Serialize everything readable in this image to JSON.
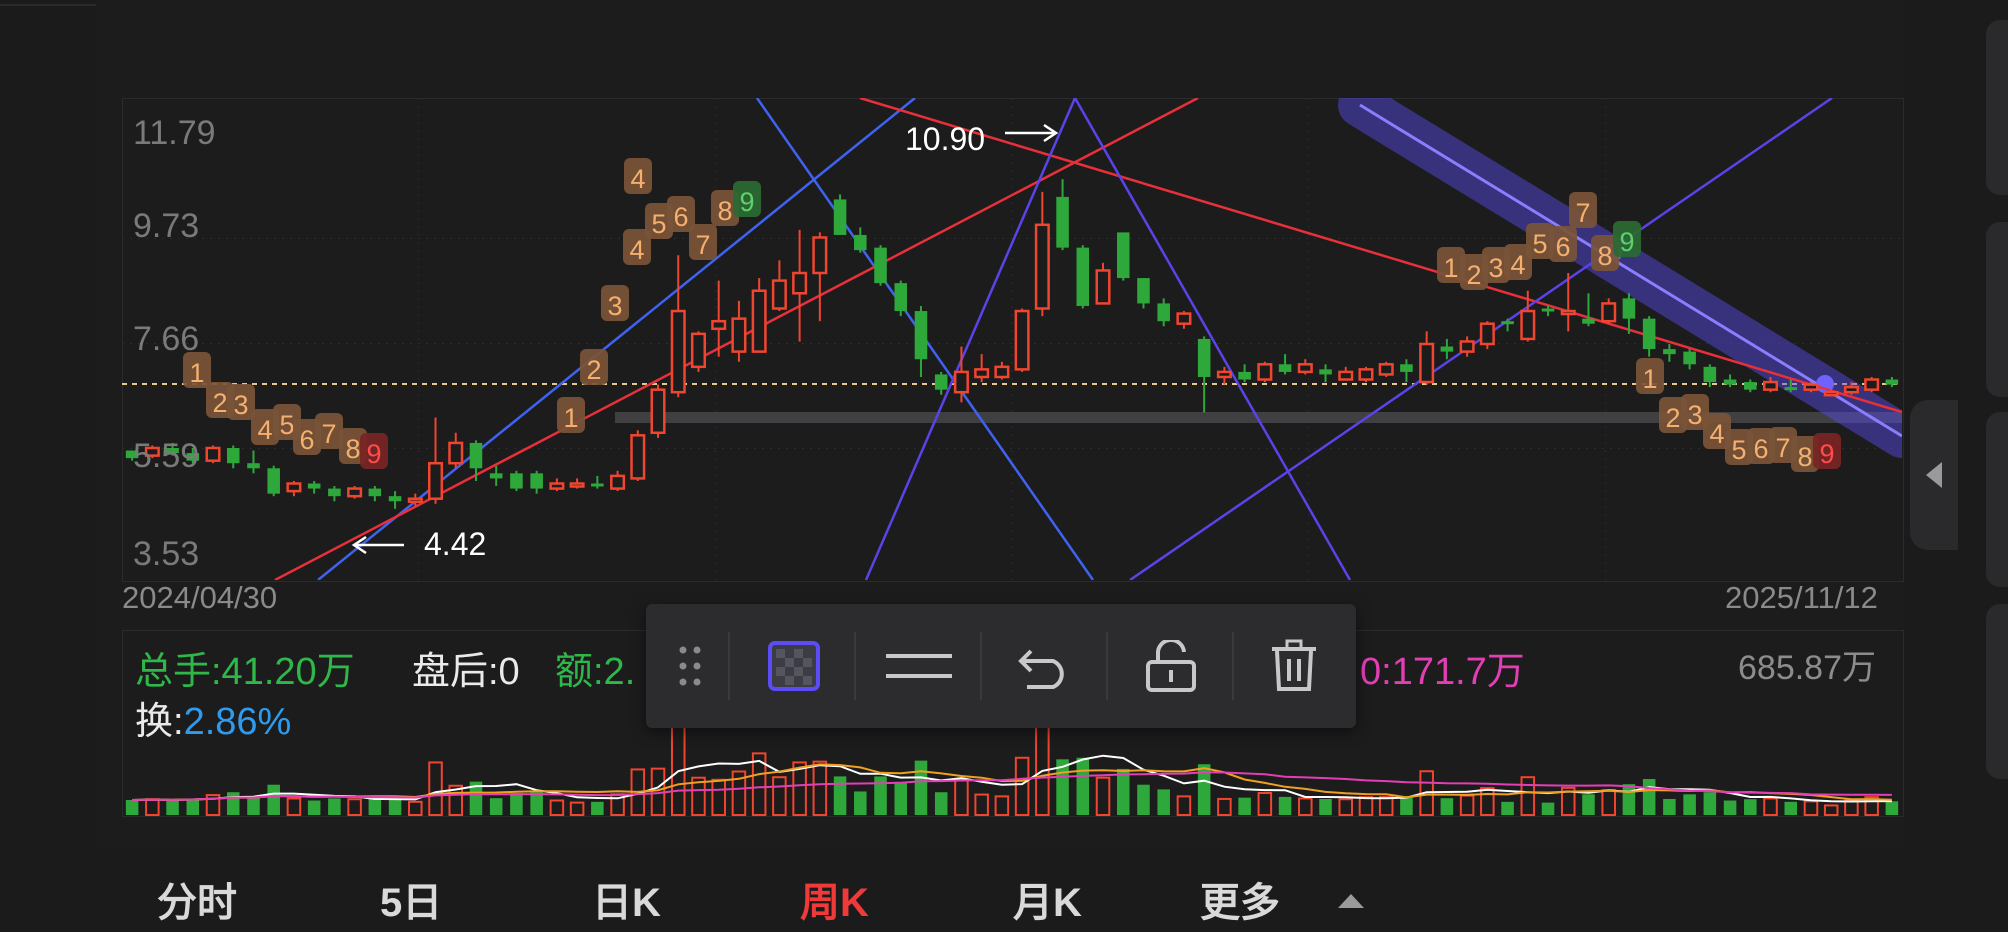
{
  "chart": {
    "price_ticks": [
      "11.79",
      "9.73",
      "7.66",
      "5.59",
      "3.53"
    ],
    "date_start": "2024/04/30",
    "date_end": "2025/11/12",
    "high_label": "10.90",
    "low_label": "4.42"
  },
  "volume_info": {
    "total_label": "总手:41.20万",
    "after_hours_label": "盘后:0",
    "amount_label": "额:2.",
    "ma_label": "0:171.7万",
    "max_volume": "685.87万",
    "turnover_label": "换:",
    "turnover_value": "2.86%"
  },
  "toolbar": {
    "icons": [
      "drag-handle-icon",
      "fill-pattern-icon",
      "line-style-icon",
      "undo-icon",
      "lock-icon",
      "delete-icon"
    ]
  },
  "tabs": [
    {
      "label": "分时",
      "active": false
    },
    {
      "label": "5日",
      "active": false
    },
    {
      "label": "日K",
      "active": false
    },
    {
      "label": "周K",
      "active": true
    },
    {
      "label": "月K",
      "active": false
    },
    {
      "label": "更多",
      "active": false
    }
  ],
  "colors": {
    "up": "#f0452e",
    "down": "#2ea83a",
    "sequence_marker": "#d98a46",
    "trendline_blue": "#4a6cff",
    "trendline_red": "#e8303a",
    "channel": "#5a4cf0"
  },
  "chart_data": {
    "type": "candlestick",
    "ylim": [
      3.53,
      11.79
    ],
    "y_ticks": [
      11.79,
      9.73,
      7.66,
      5.59,
      3.53
    ],
    "x_range": [
      "2024/04/30",
      "2025/11/12"
    ],
    "annotations": [
      {
        "text": "10.90",
        "value": 10.9
      },
      {
        "text": "4.42",
        "value": 4.42
      }
    ],
    "candles": [
      [
        5.55,
        5.4,
        5.55,
        5.35
      ],
      [
        5.45,
        5.6,
        5.65,
        5.4
      ],
      [
        5.6,
        5.5,
        5.7,
        5.45
      ],
      [
        5.5,
        5.35,
        5.6,
        5.3
      ],
      [
        5.35,
        5.6,
        5.65,
        5.3
      ],
      [
        5.6,
        5.3,
        5.65,
        5.2
      ],
      [
        5.3,
        5.2,
        5.55,
        5.1
      ],
      [
        5.2,
        4.7,
        5.25,
        4.65
      ],
      [
        4.75,
        4.9,
        4.95,
        4.65
      ],
      [
        4.9,
        4.8,
        4.95,
        4.7
      ],
      [
        4.8,
        4.65,
        4.85,
        4.55
      ],
      [
        4.65,
        4.8,
        4.85,
        4.6
      ],
      [
        4.8,
        4.65,
        4.85,
        4.55
      ],
      [
        4.65,
        4.55,
        4.75,
        4.4
      ],
      [
        4.55,
        4.6,
        4.7,
        4.45
      ],
      [
        4.6,
        5.3,
        6.2,
        4.5
      ],
      [
        5.3,
        5.7,
        5.9,
        5.2
      ],
      [
        5.7,
        5.2,
        5.75,
        4.95
      ],
      [
        5.1,
        5.0,
        5.25,
        4.85
      ],
      [
        5.1,
        4.8,
        5.15,
        4.75
      ],
      [
        5.1,
        4.8,
        5.15,
        4.7
      ],
      [
        4.8,
        4.9,
        5.0,
        4.75
      ],
      [
        4.85,
        4.9,
        5.0,
        4.8
      ],
      [
        4.9,
        4.85,
        5.05,
        4.8
      ],
      [
        4.8,
        5.05,
        5.15,
        4.75
      ],
      [
        5.0,
        5.85,
        5.95,
        4.95
      ],
      [
        5.9,
        6.75,
        6.85,
        5.8
      ],
      [
        6.7,
        8.3,
        9.4,
        6.6
      ],
      [
        7.2,
        7.85,
        7.9,
        7.1
      ],
      [
        7.95,
        8.1,
        8.9,
        7.4
      ],
      [
        7.5,
        8.15,
        8.5,
        7.3
      ],
      [
        7.5,
        8.7,
        8.95,
        7.5
      ],
      [
        8.35,
        8.9,
        9.3,
        8.3
      ],
      [
        8.65,
        9.05,
        9.9,
        7.7
      ],
      [
        9.05,
        9.75,
        9.85,
        8.1
      ],
      [
        10.5,
        9.8,
        10.6,
        9.8
      ],
      [
        9.8,
        9.5,
        9.95,
        9.45
      ],
      [
        9.55,
        8.85,
        9.6,
        8.8
      ],
      [
        8.85,
        8.3,
        8.9,
        8.2
      ],
      [
        8.3,
        7.35,
        8.4,
        7.0
      ],
      [
        7.05,
        6.75,
        7.1,
        6.65
      ],
      [
        6.7,
        7.1,
        7.6,
        6.5
      ],
      [
        7.0,
        7.15,
        7.45,
        6.9
      ],
      [
        7.0,
        7.2,
        7.3,
        6.95
      ],
      [
        7.15,
        8.3,
        8.35,
        7.1
      ],
      [
        8.35,
        10.0,
        10.65,
        8.2
      ],
      [
        10.55,
        9.55,
        10.9,
        9.5
      ],
      [
        9.55,
        8.4,
        9.6,
        8.35
      ],
      [
        8.45,
        9.1,
        9.25,
        8.45
      ],
      [
        9.85,
        8.95,
        9.85,
        8.9
      ],
      [
        8.95,
        8.45,
        8.95,
        8.35
      ],
      [
        8.45,
        8.1,
        8.55,
        8.0
      ],
      [
        8.05,
        8.25,
        8.3,
        7.95
      ],
      [
        7.75,
        7.0,
        7.8,
        6.3
      ],
      [
        7.0,
        7.1,
        7.2,
        6.85
      ],
      [
        7.1,
        6.95,
        7.25,
        6.9
      ],
      [
        6.95,
        7.25,
        7.3,
        6.9
      ],
      [
        7.25,
        7.1,
        7.45,
        7.05
      ],
      [
        7.1,
        7.25,
        7.35,
        7.05
      ],
      [
        7.15,
        7.05,
        7.25,
        6.9
      ],
      [
        6.95,
        7.1,
        7.2,
        6.95
      ],
      [
        6.95,
        7.15,
        7.2,
        6.9
      ],
      [
        7.05,
        7.25,
        7.3,
        7.0
      ],
      [
        7.25,
        7.1,
        7.35,
        6.9
      ],
      [
        6.9,
        7.65,
        7.9,
        6.85
      ],
      [
        7.6,
        7.5,
        7.75,
        7.35
      ],
      [
        7.5,
        7.7,
        7.8,
        7.4
      ],
      [
        7.65,
        8.05,
        8.1,
        7.55
      ],
      [
        8.1,
        8.05,
        8.15,
        7.9
      ],
      [
        7.75,
        8.3,
        8.7,
        7.7
      ],
      [
        8.35,
        8.3,
        8.4,
        8.2
      ],
      [
        8.25,
        8.3,
        9.05,
        7.9
      ],
      [
        8.15,
        8.05,
        8.65,
        8.0
      ],
      [
        8.1,
        8.45,
        8.55,
        8.05
      ],
      [
        8.55,
        8.15,
        8.65,
        7.85
      ],
      [
        8.15,
        7.55,
        8.2,
        7.4
      ],
      [
        7.55,
        7.45,
        7.65,
        7.3
      ],
      [
        7.5,
        7.25,
        7.55,
        7.15
      ],
      [
        7.2,
        6.9,
        7.25,
        6.8
      ],
      [
        6.95,
        6.85,
        7.05,
        6.8
      ],
      [
        6.9,
        6.75,
        6.95,
        6.7
      ],
      [
        6.75,
        6.9,
        7.0,
        6.7
      ],
      [
        6.8,
        6.75,
        6.95,
        6.7
      ],
      [
        6.75,
        6.85,
        6.9,
        6.7
      ],
      [
        6.7,
        6.7,
        6.75,
        6.65
      ],
      [
        6.7,
        6.8,
        6.9,
        6.65
      ],
      [
        6.75,
        6.95,
        7.0,
        6.7
      ],
      [
        6.95,
        6.85,
        7.0,
        6.8
      ]
    ]
  }
}
